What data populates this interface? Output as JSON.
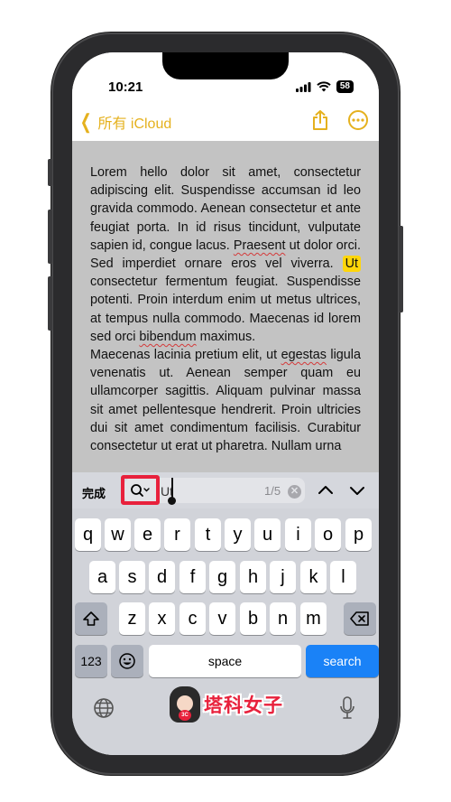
{
  "status_bar": {
    "time": "10:21",
    "battery": "58"
  },
  "nav": {
    "back_label": "所有 iCloud"
  },
  "note": {
    "paragraph1": {
      "before": "Lorem hello dolor sit amet, consectetur adipiscing elit. Suspendisse accumsan id leo gravida commodo. Aenean consectetur et ante feugiat porta. In id risus tincidunt, vulputate sapien id, congue lacus. ",
      "sq1": "Praesent",
      "mid1": " ut dolor orci. Sed imperdiet ornare eros vel viverra. ",
      "highlight": "Ut",
      "mid2": " consectetur fermentum feugiat. Suspendisse potenti. Proin interdum enim ut metus ultrices, at tempus nulla commodo. Maecenas id lorem sed orci ",
      "sq2": "bibendum",
      "after": " maximus."
    },
    "paragraph2": {
      "before": "Maecenas lacinia pretium elit, ut ",
      "sq1": "egestas",
      "after": " ligula venenatis ut. Aenean semper quam eu ullamcorper sagittis. Aliquam pulvinar massa sit amet pellentesque hendrerit. Proin ultricies dui sit amet condimentum facilisis. Curabitur consectetur ut erat ut pharetra. Nullam urna"
    }
  },
  "find_bar": {
    "done_label": "完成",
    "query": "Ut",
    "match_count": "1/5"
  },
  "keyboard": {
    "row1": [
      "q",
      "w",
      "e",
      "r",
      "t",
      "y",
      "u",
      "i",
      "o",
      "p"
    ],
    "row2": [
      "a",
      "s",
      "d",
      "f",
      "g",
      "h",
      "j",
      "k",
      "l"
    ],
    "row3": [
      "z",
      "x",
      "c",
      "v",
      "b",
      "n",
      "m"
    ],
    "numbers_label": "123",
    "space_label": "space",
    "search_label": "search"
  },
  "watermark": {
    "text": "塔科女子",
    "badge": "3C"
  },
  "colors": {
    "accent": "#e5b11e",
    "highlight": "#ffd60a",
    "search_key": "#1a82f7",
    "callout": "#e8213c"
  },
  "icons": [
    "share-icon",
    "more-icon",
    "search-icon",
    "chevron-up-icon",
    "chevron-down-icon",
    "shift-icon",
    "delete-icon",
    "emoji-icon",
    "globe-icon",
    "mic-icon"
  ]
}
